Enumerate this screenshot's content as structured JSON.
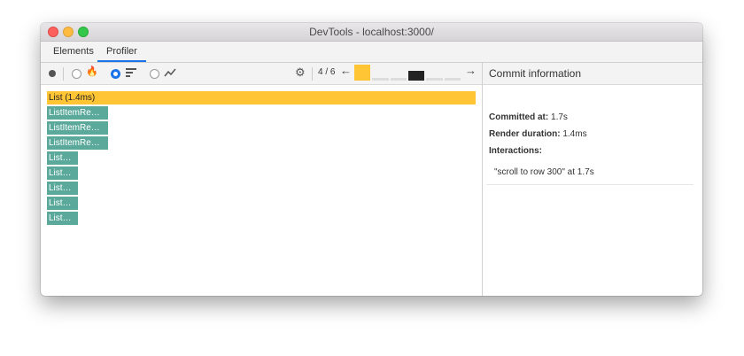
{
  "window": {
    "title": "DevTools - localhost:3000/"
  },
  "tabs": [
    {
      "label": "Elements",
      "active": false
    },
    {
      "label": "Profiler",
      "active": true
    }
  ],
  "toolbar": {
    "commit_index": "4 / 6",
    "prev_icon": "←",
    "next_icon": "→",
    "flame_icon": "🔥",
    "gear_icon": "⚙",
    "selected_view": "ranked"
  },
  "commits": {
    "selected": 4,
    "count": 6,
    "heights": [
      1.0,
      0.15,
      0.15,
      0.6,
      0.15,
      0.15
    ],
    "colors": {
      "selected": "#ffc534",
      "active": "#222222",
      "inactive": "#dddddd"
    }
  },
  "flamegraph": {
    "root": {
      "label": "List (1.4ms)"
    },
    "children": [
      {
        "label": "ListItemRe…"
      },
      {
        "label": "ListItemRe…"
      },
      {
        "label": "ListItemRe…"
      },
      {
        "label": "List…"
      },
      {
        "label": "List…"
      },
      {
        "label": "List…"
      },
      {
        "label": "List…"
      },
      {
        "label": "List…"
      }
    ]
  },
  "commit_info": {
    "title": "Commit information",
    "committed_at_label": "Committed at:",
    "committed_at_value": "1.7s",
    "render_duration_label": "Render duration:",
    "render_duration_value": "1.4ms",
    "interactions_label": "Interactions:",
    "interactions": [
      "\"scroll to row 300\" at 1.7s"
    ]
  }
}
